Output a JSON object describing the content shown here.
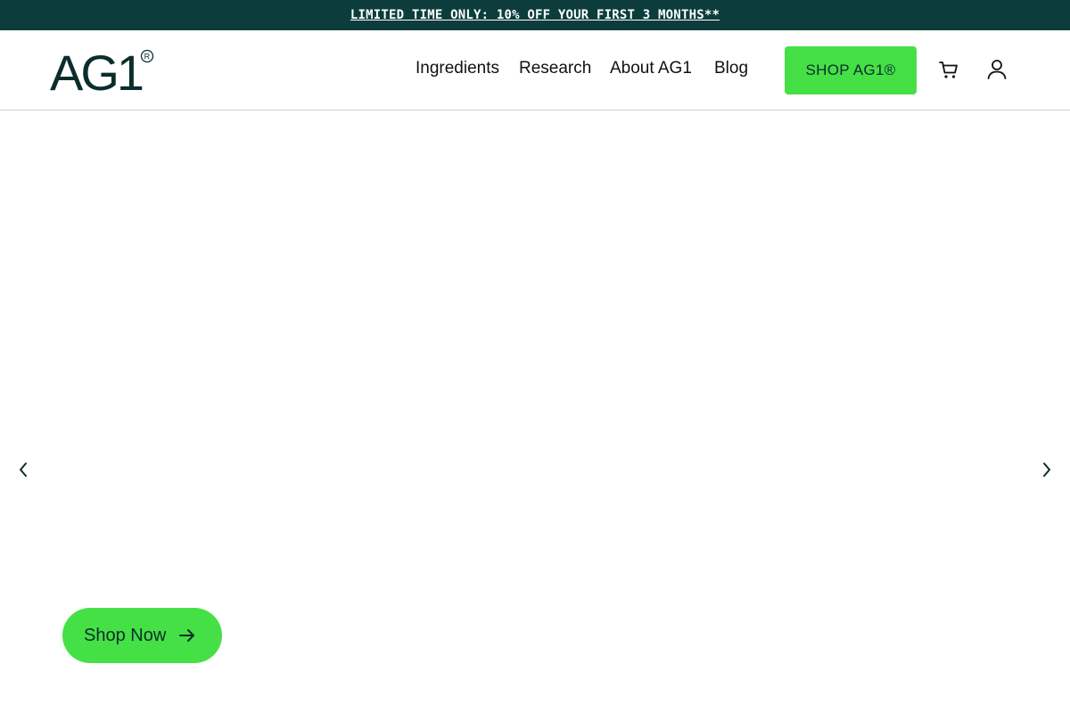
{
  "announcement": {
    "text": "LIMITED TIME ONLY: 10% OFF YOUR FIRST 3 MONTHS**"
  },
  "header": {
    "logo_text": "AG1",
    "logo_mark": "®",
    "nav": [
      {
        "label": "Ingredients"
      },
      {
        "label": "Research"
      },
      {
        "label": "About AG1"
      },
      {
        "label": "Blog"
      }
    ],
    "shop_button": "SHOP AG1®",
    "icons": [
      "cart-icon",
      "account-icon"
    ]
  },
  "hero": {
    "cta_label": "Shop Now",
    "prev_icon": "chevron-left-icon",
    "next_icon": "chevron-right-icon"
  },
  "colors": {
    "announcement_bg": "#0c3c3c",
    "accent_green": "#45e045",
    "brand_dark": "#0b2d2c"
  }
}
